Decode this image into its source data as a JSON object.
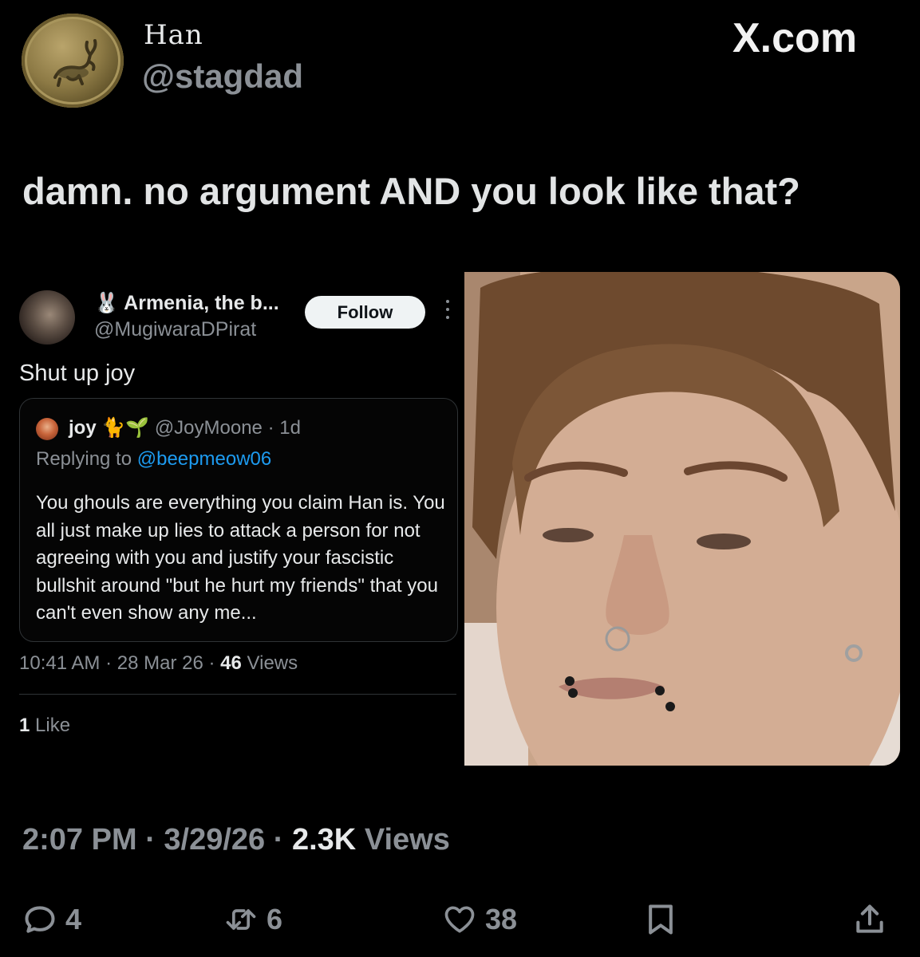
{
  "header": {
    "display_name": "Han",
    "handle": "@stagdad",
    "brand": "X.com",
    "avatar_icon": "stag-coin-avatar"
  },
  "tweet": {
    "text": "damn. no argument AND you look like that?",
    "time": "2:07 PM",
    "date": "3/29/26",
    "views_count": "2.3K",
    "views_label": "Views"
  },
  "quoted": {
    "name_emoji": "🐰",
    "name": "Armenia, the b...",
    "handle": "@MugiwaraDPirat",
    "follow_label": "Follow",
    "body": "Shut up joy",
    "inner": {
      "name": "joy",
      "name_emoji_cat": "🐈",
      "name_emoji_sprout": "🌱",
      "handle": "@JoyMoone",
      "age": "1d",
      "replying_prefix": "Replying to",
      "replying_to": "@beepmeow06",
      "text": "You ghouls are everything you claim Han is. You all just make up lies to attack a person for not agreeing with you and justify your fascistic bullshit around \"but he hurt my friends\" that you can't even show any me..."
    },
    "time": "10:41 AM",
    "date": "28 Mar 26",
    "views_count": "46",
    "views_label": "Views",
    "likes_count": "1",
    "likes_label": "Like"
  },
  "actions": {
    "reply_count": "4",
    "repost_count": "6",
    "like_count": "38"
  },
  "colors": {
    "background": "#000000",
    "text_primary": "#e7e9ea",
    "text_secondary": "#8b9096",
    "link": "#1d9bf0",
    "border": "#2f3336"
  }
}
